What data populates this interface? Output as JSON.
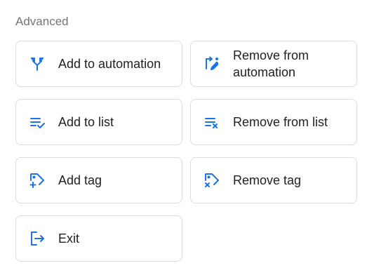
{
  "section": {
    "title": "Advanced"
  },
  "accent_color": "#1a73e8",
  "actions": [
    {
      "label": "Add to automation",
      "icon": "fork-split-icon"
    },
    {
      "label": "Remove from automation",
      "icon": "route-edit-icon"
    },
    {
      "label": "Add to list",
      "icon": "playlist-add-check-icon"
    },
    {
      "label": "Remove from list",
      "icon": "playlist-remove-icon"
    },
    {
      "label": "Add tag",
      "icon": "tag-add-icon"
    },
    {
      "label": "Remove tag",
      "icon": "tag-remove-icon"
    },
    {
      "label": "Exit",
      "icon": "exit-icon"
    }
  ]
}
